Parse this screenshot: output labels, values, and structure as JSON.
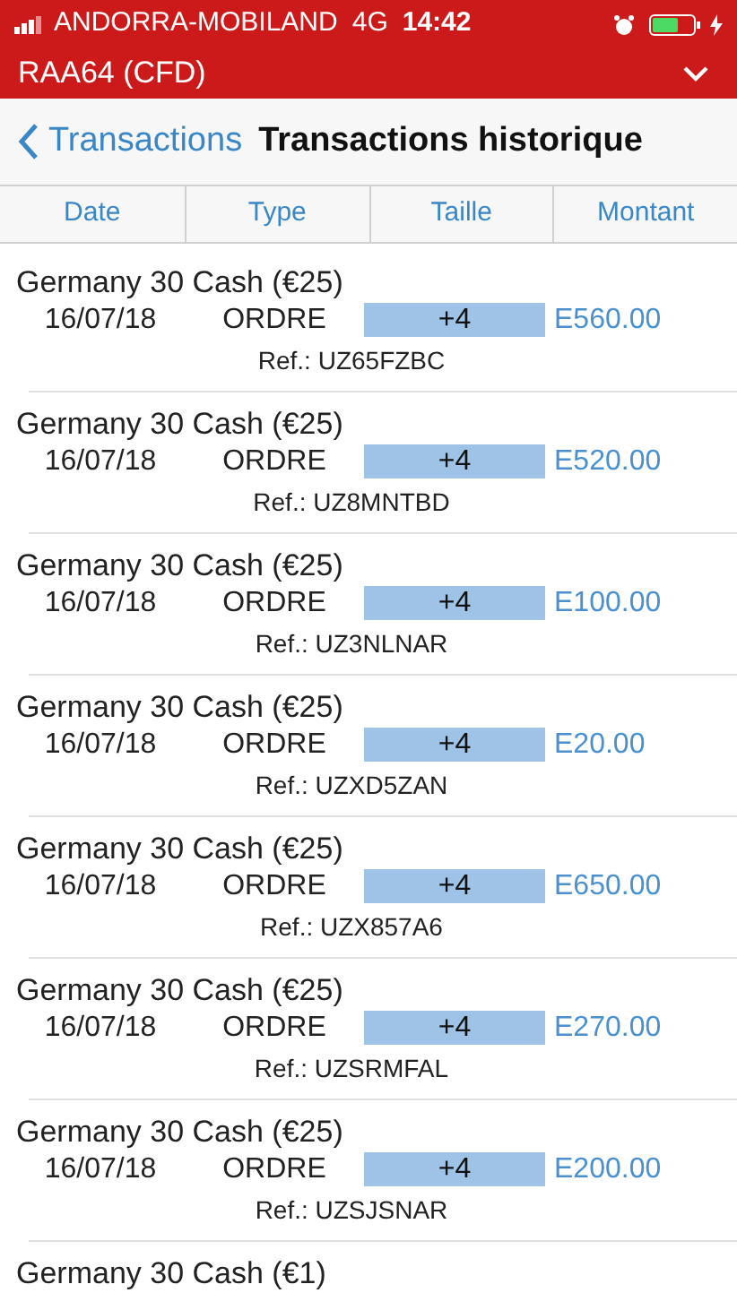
{
  "status_bar": {
    "carrier": "ANDORRA-MOBILAND",
    "network": "4G",
    "time": "14:42"
  },
  "account_bar": {
    "title": "RAA64 (CFD)"
  },
  "nav": {
    "back": "Transactions",
    "title": "Transactions historique"
  },
  "columns": [
    "Date",
    "Type",
    "Taille",
    "Montant"
  ],
  "rows": [
    {
      "instrument": "Germany 30 Cash (€25)",
      "date": "16/07/18",
      "type": "ORDRE",
      "size": "+4",
      "amount": "E560.00",
      "ref": "Ref.: UZ65FZBC"
    },
    {
      "instrument": "Germany 30 Cash (€25)",
      "date": "16/07/18",
      "type": "ORDRE",
      "size": "+4",
      "amount": "E520.00",
      "ref": "Ref.: UZ8MNTBD"
    },
    {
      "instrument": "Germany 30 Cash (€25)",
      "date": "16/07/18",
      "type": "ORDRE",
      "size": "+4",
      "amount": "E100.00",
      "ref": "Ref.: UZ3NLNAR"
    },
    {
      "instrument": "Germany 30 Cash (€25)",
      "date": "16/07/18",
      "type": "ORDRE",
      "size": "+4",
      "amount": "E20.00",
      "ref": "Ref.: UZXD5ZAN"
    },
    {
      "instrument": "Germany 30 Cash (€25)",
      "date": "16/07/18",
      "type": "ORDRE",
      "size": "+4",
      "amount": "E650.00",
      "ref": "Ref.: UZX857A6"
    },
    {
      "instrument": "Germany 30 Cash (€25)",
      "date": "16/07/18",
      "type": "ORDRE",
      "size": "+4",
      "amount": "E270.00",
      "ref": "Ref.: UZSRMFAL"
    },
    {
      "instrument": "Germany 30 Cash (€25)",
      "date": "16/07/18",
      "type": "ORDRE",
      "size": "+4",
      "amount": "E200.00",
      "ref": "Ref.: UZSJSNAR"
    },
    {
      "instrument": "Germany 30 Cash (€1)"
    }
  ]
}
